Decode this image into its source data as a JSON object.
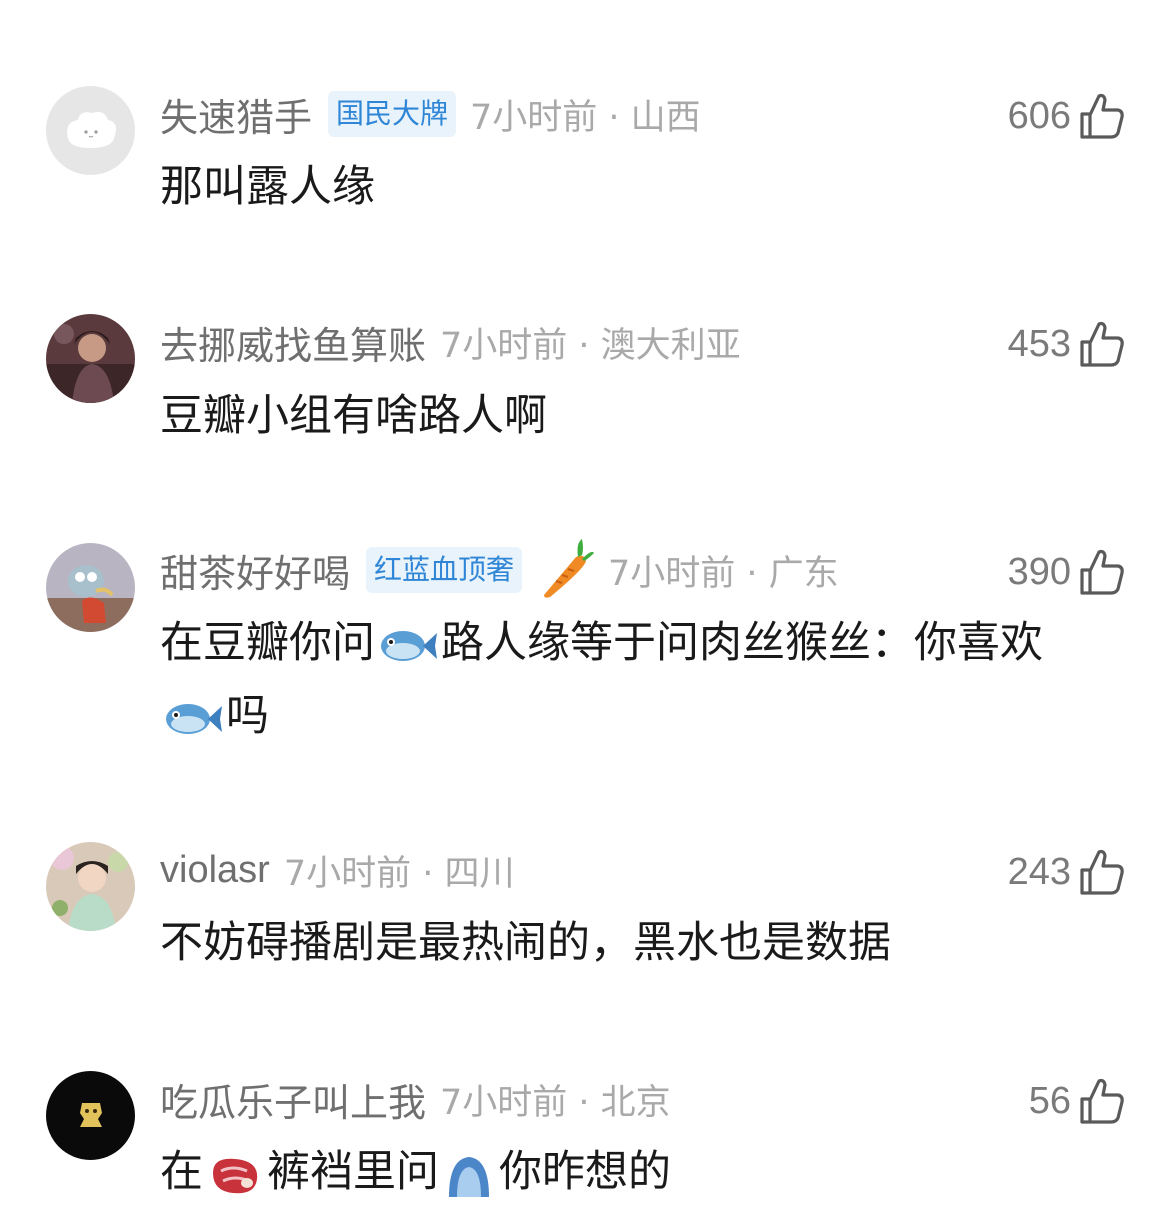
{
  "comments": [
    {
      "username": "失速猎手",
      "badge": "国民大牌",
      "time_location": "7小时前 · 山西",
      "likes": "606",
      "text": "那叫露人缘"
    },
    {
      "username": "去挪威找鱼算账",
      "time_location": "7小时前 · 澳大利亚",
      "likes": "453",
      "text": "豆瓣小组有啥路人啊"
    },
    {
      "username": "甜茶好好喝",
      "badge": "红蓝血顶奢",
      "time_location": "7小时前 · 广东",
      "likes": "390",
      "text_part1": "在豆瓣你问",
      "text_part2": "路人缘等于问肉丝猴丝：你喜欢",
      "text_part3": "吗"
    },
    {
      "username": "violasr",
      "time_location": "7小时前 · 四川",
      "likes": "243",
      "text": "不妨碍播剧是最热闹的，黑水也是数据"
    },
    {
      "username": "吃瓜乐子叫上我",
      "time_location": "7小时前 · 北京",
      "likes": "56",
      "text_part1": "在",
      "text_part2": "裤裆里问",
      "text_part3": "你昨想的"
    }
  ],
  "icons": {
    "like": "thumbs-up-icon",
    "fish": "fish-emoji",
    "carrot": "carrot-icon",
    "meat": "meat-emoji",
    "emoji_blue": "blue-emoji"
  },
  "colors": {
    "username": "#6f6f6f",
    "badge_text": "#2f86d6",
    "badge_bg": "#e9f3fb",
    "time": "#a9a9a9",
    "body_text": "#1a1a1a"
  }
}
